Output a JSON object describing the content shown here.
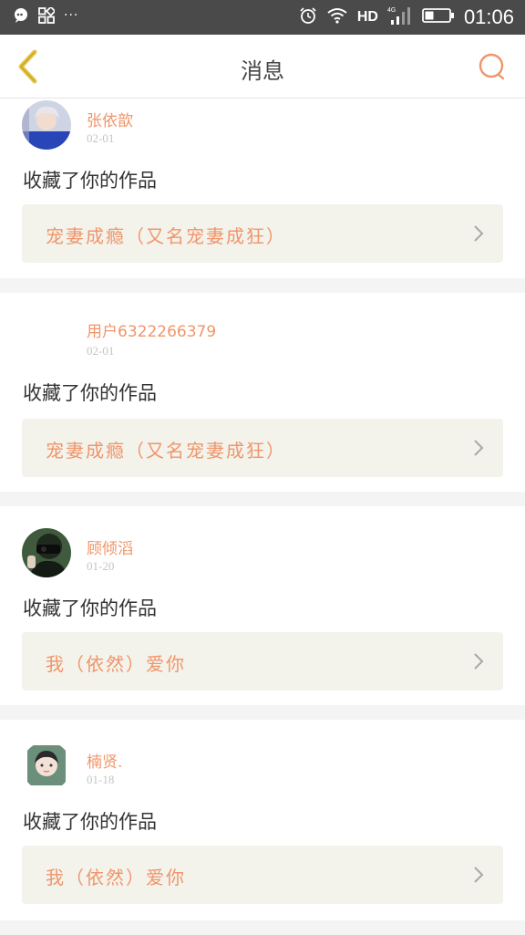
{
  "status_bar": {
    "ellipsis": "···",
    "network": "HD",
    "network_type": "4G",
    "time": "01:06"
  },
  "header": {
    "title": "消息"
  },
  "messages": [
    {
      "username": "张依歆",
      "date": "02-01",
      "action": "收藏了你的作品",
      "work_title": "宠妻成瘾（又名宠妻成狂）",
      "avatar": "photo"
    },
    {
      "username": "用户6322266379",
      "date": "02-01",
      "action": "收藏了你的作品",
      "work_title": "宠妻成瘾（又名宠妻成狂）",
      "avatar": "none"
    },
    {
      "username": "顾倾滔",
      "date": "01-20",
      "action": "收藏了你的作品",
      "work_title": "我（依然）爱你",
      "avatar": "photo"
    },
    {
      "username": "楠贤.",
      "date": "01-18",
      "action": "收藏了你的作品",
      "work_title": "我（依然）爱你",
      "avatar": "photo"
    }
  ],
  "colors": {
    "accent": "#f0956a",
    "back_arrow": "#e8c640",
    "status_bar": "#4a4a4a",
    "link_background": "#f3f3ec"
  }
}
